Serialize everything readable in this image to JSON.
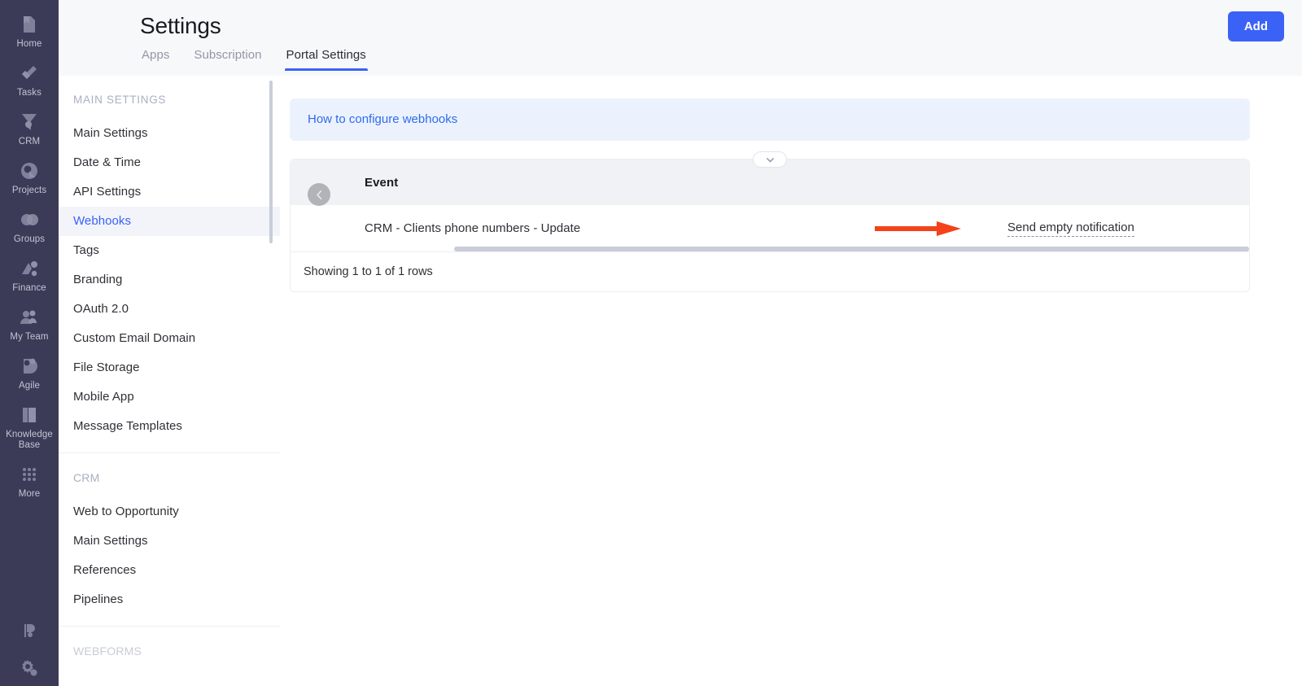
{
  "rail": {
    "items": [
      {
        "label": "Home",
        "icon": "home-icon"
      },
      {
        "label": "Tasks",
        "icon": "tasks-icon"
      },
      {
        "label": "CRM",
        "icon": "crm-icon"
      },
      {
        "label": "Projects",
        "icon": "projects-icon"
      },
      {
        "label": "Groups",
        "icon": "groups-icon"
      },
      {
        "label": "Finance",
        "icon": "finance-icon"
      },
      {
        "label": "My Team",
        "icon": "my-team-icon"
      },
      {
        "label": "Agile",
        "icon": "agile-icon"
      },
      {
        "label": "Knowledge Base",
        "icon": "knowledge-base-icon"
      },
      {
        "label": "More",
        "icon": "more-grid-icon"
      }
    ],
    "bottom_icons": [
      "support-icon",
      "settings-gear-icon"
    ]
  },
  "header": {
    "title": "Settings",
    "tabs": [
      {
        "label": "Apps",
        "active": false
      },
      {
        "label": "Subscription",
        "active": false
      },
      {
        "label": "Portal Settings",
        "active": true
      }
    ],
    "add_button": "Add",
    "accent_color": "#3b62f6"
  },
  "settings_nav": {
    "groups": [
      {
        "title": "MAIN SETTINGS",
        "items": [
          {
            "label": "Main Settings",
            "active": false
          },
          {
            "label": "Date & Time",
            "active": false
          },
          {
            "label": "API Settings",
            "active": false
          },
          {
            "label": "Webhooks",
            "active": true
          },
          {
            "label": "Tags",
            "active": false
          },
          {
            "label": "Branding",
            "active": false
          },
          {
            "label": "OAuth 2.0",
            "active": false
          },
          {
            "label": "Custom Email Domain",
            "active": false
          },
          {
            "label": "File Storage",
            "active": false
          },
          {
            "label": "Mobile App",
            "active": false
          },
          {
            "label": "Message Templates",
            "active": false
          }
        ]
      },
      {
        "title": "CRM",
        "items": [
          {
            "label": "Web to Opportunity",
            "active": false
          },
          {
            "label": "Main Settings",
            "active": false
          },
          {
            "label": "References",
            "active": false
          },
          {
            "label": "Pipelines",
            "active": false
          }
        ]
      },
      {
        "title": "WEBFORMS",
        "items": []
      }
    ]
  },
  "content": {
    "banner_link": "How to configure webhooks",
    "table": {
      "columns": [
        "Event"
      ],
      "rows": [
        {
          "event": "CRM - Clients phone numbers - Update",
          "action": "Send empty notification"
        }
      ],
      "footer": "Showing 1 to 1 of 1 rows"
    },
    "annotation": {
      "type": "arrow",
      "color": "#f4421a",
      "points_to": "Send empty notification"
    }
  }
}
